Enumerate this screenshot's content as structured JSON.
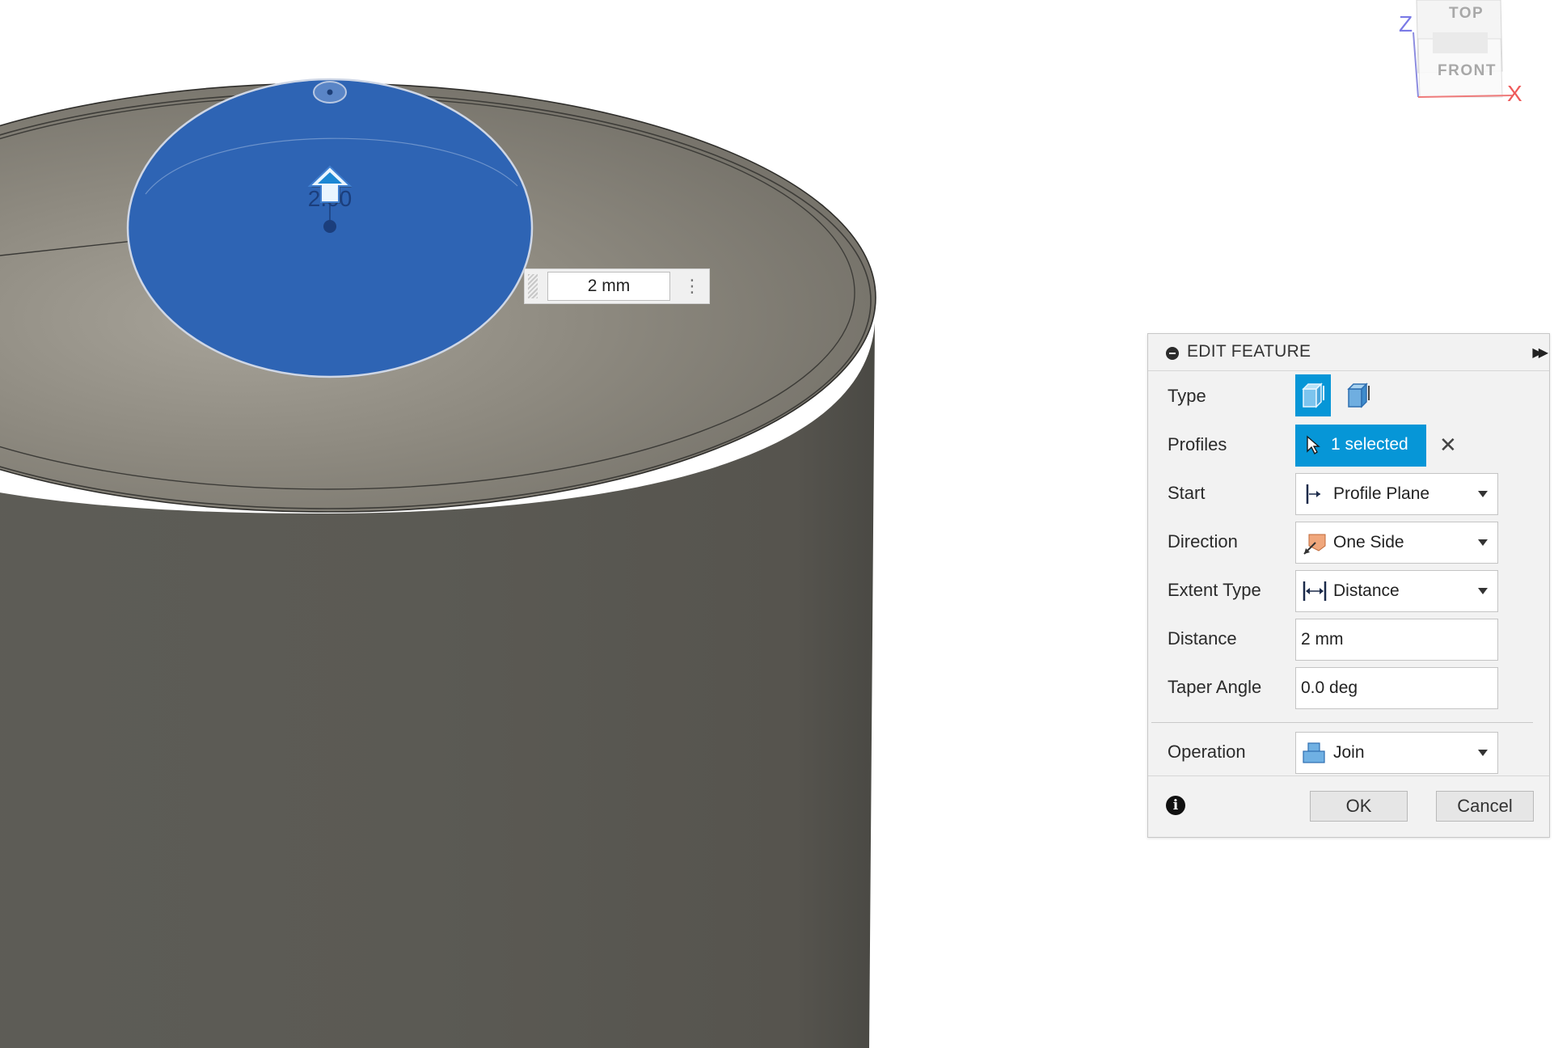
{
  "canvas": {
    "dimension_value": "2 mm",
    "profile_label": "2.00",
    "body_color": "#5a5852",
    "profile_color": "#2e64b4"
  },
  "viewcube": {
    "top_label": "TOP",
    "front_label": "FRONT",
    "axis_z": "Z",
    "axis_x": "X"
  },
  "panel": {
    "title": "EDIT FEATURE",
    "rows": {
      "type": {
        "label": "Type"
      },
      "profiles": {
        "label": "Profiles",
        "value": "1 selected"
      },
      "start": {
        "label": "Start",
        "value": "Profile Plane"
      },
      "direction": {
        "label": "Direction",
        "value": "One Side"
      },
      "extent_type": {
        "label": "Extent Type",
        "value": "Distance"
      },
      "distance": {
        "label": "Distance",
        "value": "2 mm"
      },
      "taper_angle": {
        "label": "Taper Angle",
        "value": "0.0 deg"
      },
      "operation": {
        "label": "Operation",
        "value": "Join"
      }
    },
    "ok_label": "OK",
    "cancel_label": "Cancel",
    "accent_color": "#0696d7"
  }
}
